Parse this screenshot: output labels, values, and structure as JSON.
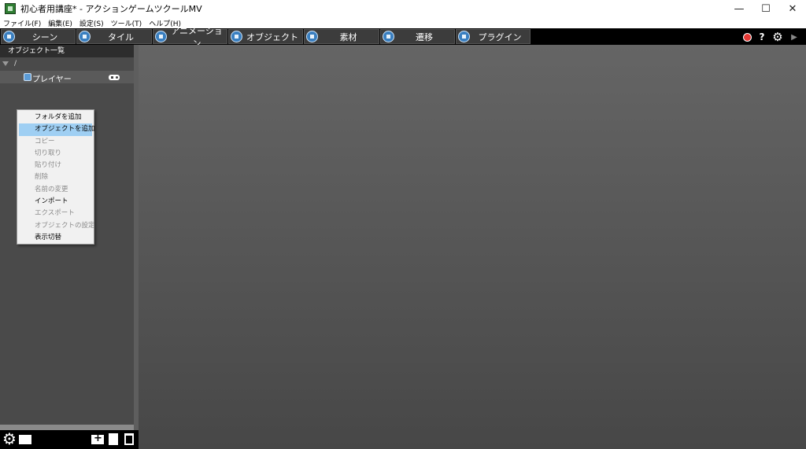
{
  "window": {
    "title": "初心者用講座* - アクションゲームツクールMV",
    "controls": [
      "—",
      "☐",
      "✕"
    ]
  },
  "menu": [
    "ファイル(F)",
    "編集(E)",
    "設定(S)",
    "ツール(T)",
    "ヘルプ(H)"
  ],
  "tabs": [
    {
      "label": "シーン",
      "icon": "scene-icon"
    },
    {
      "label": "タイル",
      "icon": "tile-icon"
    },
    {
      "label": "アニメーション",
      "icon": "animation-icon"
    },
    {
      "label": "オブジェクト",
      "icon": "object-icon"
    },
    {
      "label": "素材",
      "icon": "resource-icon"
    },
    {
      "label": "遷移",
      "icon": "transition-icon"
    },
    {
      "label": "プラグイン",
      "icon": "plugin-icon"
    }
  ],
  "toolbar_right": {
    "help": "?",
    "gear": "⚙",
    "play": "▶"
  },
  "left_panel": {
    "header": "オブジェクト一覧",
    "root": "/",
    "items": [
      {
        "label": "プレイヤー",
        "icon": "gamepad-icon"
      }
    ]
  },
  "context_menu": [
    {
      "label": "フォルダを追加",
      "enabled": true
    },
    {
      "label": "オブジェクトを追加",
      "enabled": true,
      "selected": true
    },
    {
      "label": "コピー",
      "enabled": false
    },
    {
      "label": "切り取り",
      "enabled": false
    },
    {
      "label": "貼り付け",
      "enabled": false
    },
    {
      "label": "削除",
      "enabled": false
    },
    {
      "label": "名前の変更",
      "enabled": false
    },
    {
      "label": "インポート",
      "enabled": true
    },
    {
      "label": "エクスポート",
      "enabled": false
    },
    {
      "label": "オブジェクトの設定",
      "enabled": false
    },
    {
      "label": "表示切替",
      "enabled": true
    }
  ],
  "colors": {
    "tab_bar": "#000000",
    "panel": "#4a4a4a",
    "main": "#565656",
    "highlight": "#9fcff3"
  }
}
